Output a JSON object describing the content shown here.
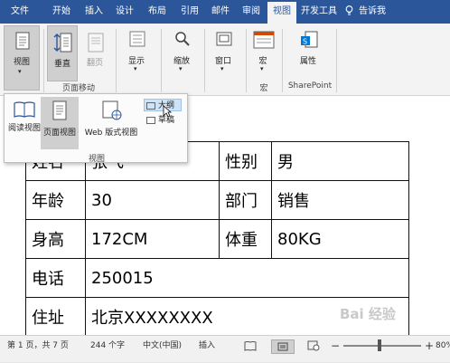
{
  "tabs": [
    "文件",
    "开始",
    "插入",
    "设计",
    "布局",
    "引用",
    "邮件",
    "审阅",
    "视图",
    "开发工具"
  ],
  "active_tab": "视图",
  "tell_me": "告诉我",
  "ribbon": {
    "view_btn": "视图",
    "vertical_btn": "垂直",
    "side_by_side_btn": "翻页",
    "page_movement_group": "页面移动",
    "show_btn": "显示",
    "zoom_btn": "缩放",
    "window_btn": "窗口",
    "macros_btn": "宏",
    "macros_group": "宏",
    "properties_btn": "属性",
    "sharepoint_group": "SharePoint"
  },
  "view_dropdown": {
    "read_mode": "阅读视图",
    "print_layout": "页面视图",
    "web_layout": "Web 版式视图",
    "outline": "大纲",
    "draft": "草稿",
    "group_label": "视图"
  },
  "table": {
    "rows": [
      [
        "姓名",
        "张飞",
        "性别",
        "男"
      ],
      [
        "年龄",
        "30",
        "部门",
        "销售"
      ],
      [
        "身高",
        "172CM",
        "体重",
        "80KG"
      ],
      [
        "电话",
        "250015"
      ],
      [
        "住址",
        "北京XXXXXXXX"
      ]
    ]
  },
  "status_bar": {
    "page": "第 1 页，共 7 页",
    "words": "244 个字",
    "language": "中文(中国)",
    "insert_mode": "插入",
    "zoom": "80%"
  },
  "watermark": "Bai 经验"
}
